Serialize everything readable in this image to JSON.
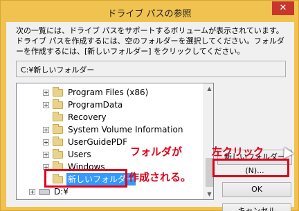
{
  "window": {
    "title": "ドライブ パスの参照",
    "close_label": "✕"
  },
  "description": "次の一覧には、ドライブ パスをサポートするボリュームが表示されています。ドライブ パスを作成するには、空のフォルダーを選択してください。フォルダーを作成するには、[新しいフォルダー] をクリックしてください。",
  "current_path": "C:¥新しいフォルダー",
  "tree": {
    "items": [
      {
        "label": "Program Files (x86)",
        "expandable": true
      },
      {
        "label": "ProgramData",
        "expandable": true
      },
      {
        "label": "Recovery",
        "expandable": false
      },
      {
        "label": "System Volume Information",
        "expandable": true
      },
      {
        "label": "UserGuidePDF",
        "expandable": true
      },
      {
        "label": "Users",
        "expandable": true
      },
      {
        "label": "Windows",
        "expandable": true
      },
      {
        "label": "新しいフォルダー",
        "expandable": false,
        "selected": true
      },
      {
        "label": "D:¥",
        "expandable": true,
        "drive": true
      }
    ]
  },
  "buttons": {
    "new_folder": "新しいフォルダー(N)...",
    "ok": "OK",
    "cancel": "キャンセル"
  },
  "annotations": {
    "folder_line1": "フォルダが",
    "folder_line2": "作成される。",
    "left_click": "左クリック"
  },
  "colors": {
    "title_bar": "#f0c24f",
    "annotation": "#e0001a",
    "selection": "#3399ff"
  }
}
